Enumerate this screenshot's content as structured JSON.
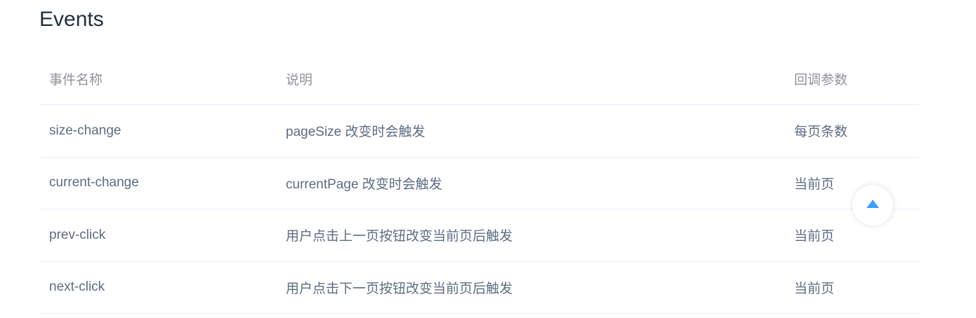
{
  "section": {
    "title": "Events"
  },
  "table": {
    "headers": [
      "事件名称",
      "说明",
      "回调参数"
    ],
    "rows": [
      [
        "size-change",
        "pageSize 改变时会触发",
        "每页条数"
      ],
      [
        "current-change",
        "currentPage 改变时会触发",
        "当前页"
      ],
      [
        "prev-click",
        "用户点击上一页按钮改变当前页后触发",
        "当前页"
      ],
      [
        "next-click",
        "用户点击下一页按钮改变当前页后触发",
        "当前页"
      ]
    ]
  },
  "back_to_top": {
    "icon": "caret-up-icon"
  },
  "colors": {
    "title": "#1f2f3d",
    "header_text": "#909399",
    "body_text": "#5e6d82",
    "row_border": "#eaeefb",
    "accent": "#409eff"
  }
}
